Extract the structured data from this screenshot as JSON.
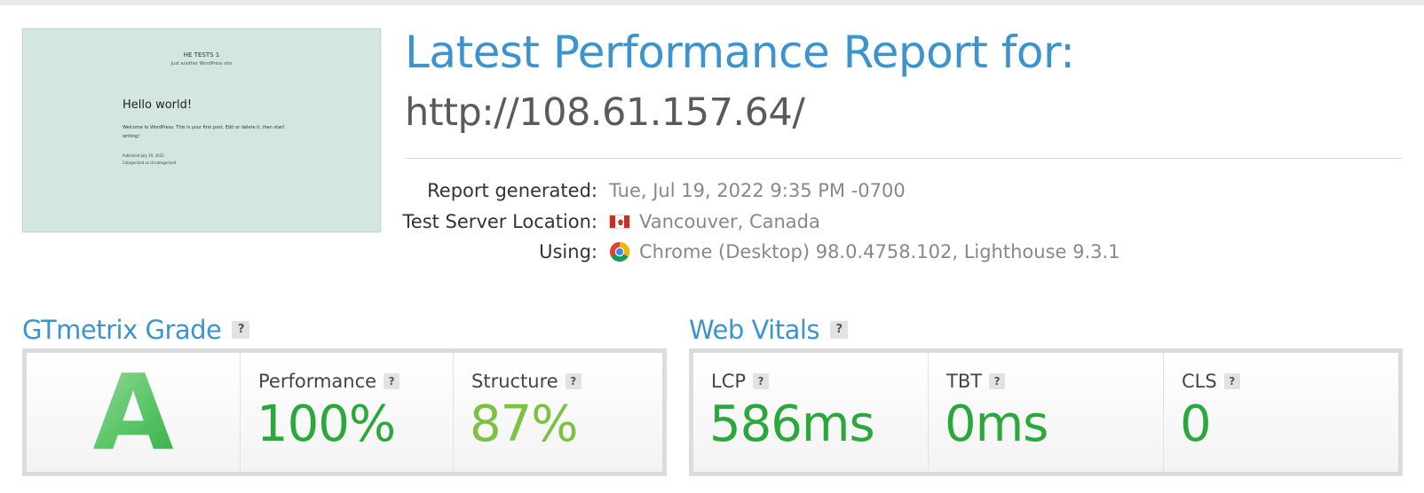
{
  "thumbnail": {
    "site_title": "HE TESTS 1",
    "site_tagline": "Just another WordPress site",
    "post_title": "Hello world!",
    "post_body": "Welcome to WordPress. This is your first post. Edit or delete it, then start writing!",
    "post_published": "Published July 19, 2022",
    "post_category": "Categorized as Uncategorized"
  },
  "header": {
    "title": "Latest Performance Report for:",
    "url": "http://108.61.157.64/"
  },
  "report": {
    "generated_label": "Report generated:",
    "generated_value": "Tue, Jul 19, 2022 9:35 PM -0700",
    "location_label": "Test Server Location:",
    "location_value": "Vancouver, Canada",
    "using_label": "Using:",
    "using_value": "Chrome (Desktop) 98.0.4758.102, Lighthouse 9.3.1"
  },
  "gtmetrix": {
    "title": "GTmetrix Grade",
    "help": "?",
    "grade": "A",
    "performance_label": "Performance",
    "performance_value": "100%",
    "structure_label": "Structure",
    "structure_value": "87%"
  },
  "web_vitals": {
    "title": "Web Vitals",
    "help": "?",
    "lcp_label": "LCP",
    "lcp_value": "586ms",
    "tbt_label": "TBT",
    "tbt_value": "0ms",
    "cls_label": "CLS",
    "cls_value": "0"
  },
  "colors": {
    "accent_blue": "#3c94cf",
    "grade_green": "#2aa83b",
    "score_green_light": "#7cc242"
  }
}
